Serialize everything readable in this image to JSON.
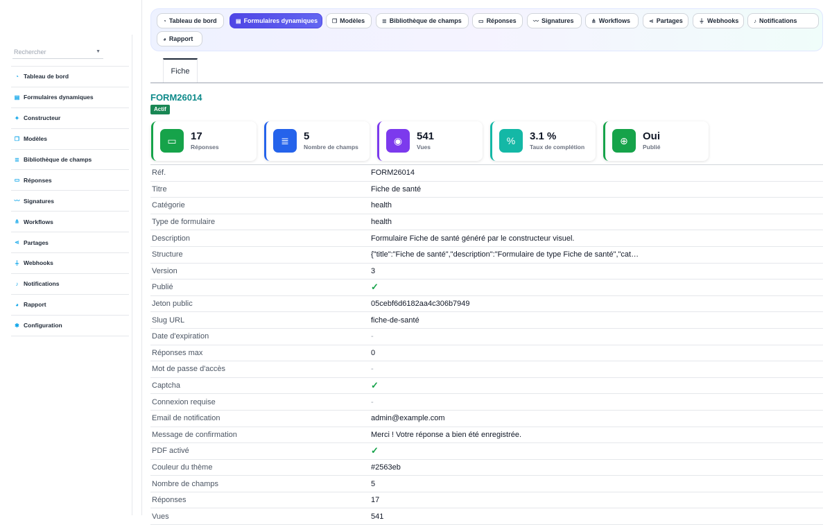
{
  "sidebar": {
    "search_placeholder": "Rechercher",
    "items": [
      {
        "label": "Tableau de bord",
        "icon": "gauge-icon"
      },
      {
        "label": "Formulaires dynamiques",
        "icon": "file-icon"
      },
      {
        "label": "Constructeur",
        "icon": "wand-icon"
      },
      {
        "label": "Modèles",
        "icon": "copy-icon"
      },
      {
        "label": "Bibliothèque de champs",
        "icon": "list-icon"
      },
      {
        "label": "Réponses",
        "icon": "inbox-icon"
      },
      {
        "label": "Signatures",
        "icon": "signature-icon"
      },
      {
        "label": "Workflows",
        "icon": "workflow-icon"
      },
      {
        "label": "Partages",
        "icon": "share-icon"
      },
      {
        "label": "Webhooks",
        "icon": "plug-icon"
      },
      {
        "label": "Notifications",
        "icon": "bell-icon"
      },
      {
        "label": "Rapport",
        "icon": "chart-pie-icon"
      },
      {
        "label": "Configuration",
        "icon": "gear-icon"
      }
    ]
  },
  "topnav": {
    "tabs": [
      {
        "label": "Tableau de bord",
        "icon": "gauge-icon"
      },
      {
        "label": "Formulaires dynamiques",
        "icon": "file-icon",
        "active": true
      },
      {
        "label": "Modèles",
        "icon": "copy-icon"
      },
      {
        "label": "Bibliothèque de champs",
        "icon": "list-icon"
      },
      {
        "label": "Réponses",
        "icon": "inbox-icon"
      },
      {
        "label": "Signatures",
        "icon": "signature-icon"
      },
      {
        "label": "Workflows",
        "icon": "workflow-icon"
      },
      {
        "label": "Partages",
        "icon": "share-icon"
      },
      {
        "label": "Webhooks",
        "icon": "plug-icon"
      },
      {
        "label": "Notifications",
        "icon": "bell-icon"
      },
      {
        "label": "Rapport",
        "icon": "chart-pie-icon"
      }
    ]
  },
  "detail": {
    "tab_label": "Fiche",
    "reference": "FORM26014",
    "status": "Actif",
    "status_color": "#198754",
    "stats": [
      {
        "value": "17",
        "label": "Réponses",
        "icon": "inbox-icon",
        "color": "#16a34a"
      },
      {
        "value": "5",
        "label": "Nombre de champs",
        "icon": "list-icon",
        "color": "#2563eb"
      },
      {
        "value": "541",
        "label": "Vues",
        "icon": "eye-icon",
        "color": "#7c3aed"
      },
      {
        "value": "3.1 %",
        "label": "Taux de complétion",
        "icon": "percent-icon",
        "color": "#14b8a6"
      },
      {
        "value": "Oui",
        "label": "Publié",
        "icon": "globe-icon",
        "color": "#16a34a"
      }
    ],
    "rows": [
      {
        "key": "Réf.",
        "value": "FORM26014"
      },
      {
        "key": "Titre",
        "value": "Fiche de santé"
      },
      {
        "key": "Catégorie",
        "value": "health"
      },
      {
        "key": "Type de formulaire",
        "value": "health"
      },
      {
        "key": "Description",
        "value": "Formulaire Fiche de santé généré par le constructeur visuel."
      },
      {
        "key": "Structure",
        "value": "{\"title\":\"Fiche de santé\",\"description\":\"Formulaire de type Fiche de santé\",\"cat…"
      },
      {
        "key": "Version",
        "value": "3"
      },
      {
        "key": "Publié",
        "value": "✓"
      },
      {
        "key": "Jeton public",
        "value": "05cebf6d6182aa4c306b7949"
      },
      {
        "key": "Slug URL",
        "value": "fiche-de-santé"
      },
      {
        "key": "Date d'expiration",
        "value": "-"
      },
      {
        "key": "Réponses max",
        "value": "0"
      },
      {
        "key": "Mot de passe d'accès",
        "value": "-"
      },
      {
        "key": "Captcha",
        "value": "✓"
      },
      {
        "key": "Connexion requise",
        "value": "-"
      },
      {
        "key": "Email de notification",
        "value": "admin@example.com"
      },
      {
        "key": "Message de confirmation",
        "value": "Merci ! Votre réponse a bien été enregistrée."
      },
      {
        "key": "PDF activé",
        "value": "✓"
      },
      {
        "key": "Couleur du thème",
        "value": "#2563eb"
      },
      {
        "key": "Nombre de champs",
        "value": "5"
      },
      {
        "key": "Réponses",
        "value": "17"
      },
      {
        "key": "Vues",
        "value": "541"
      }
    ]
  }
}
